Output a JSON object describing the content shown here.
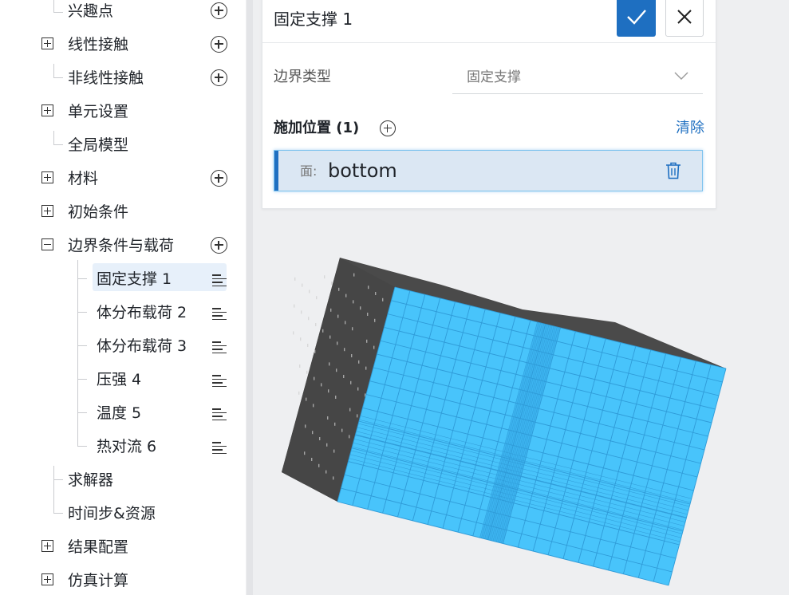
{
  "tree": {
    "items": [
      {
        "label": "兴趣点",
        "expander": "none",
        "action": "add"
      },
      {
        "label": "线性接触",
        "expander": "plus",
        "action": "add"
      },
      {
        "label": "非线性接触",
        "expander": "none",
        "action": "add"
      },
      {
        "label": "单元设置",
        "expander": "plus",
        "action": "none"
      },
      {
        "label": "全局模型",
        "expander": "none",
        "action": "none"
      },
      {
        "label": "材料",
        "expander": "plus",
        "action": "add"
      },
      {
        "label": "初始条件",
        "expander": "plus",
        "action": "none"
      },
      {
        "label": "边界条件与载荷",
        "expander": "minus",
        "action": "add"
      },
      {
        "label": "求解器",
        "expander": "none",
        "action": "none"
      },
      {
        "label": "时间步&资源",
        "expander": "none",
        "action": "none"
      },
      {
        "label": "结果配置",
        "expander": "plus",
        "action": "none"
      },
      {
        "label": "仿真计算",
        "expander": "plus",
        "action": "none"
      }
    ],
    "children": [
      {
        "label": "固定支撑 1",
        "selected": true
      },
      {
        "label": "体分布载荷 2",
        "selected": false
      },
      {
        "label": "体分布载荷 3",
        "selected": false
      },
      {
        "label": "压强 4",
        "selected": false
      },
      {
        "label": "温度 5",
        "selected": false
      },
      {
        "label": "热对流 6",
        "selected": false
      }
    ]
  },
  "panel": {
    "title": "固定支撑 1",
    "confirm_icon": "check-icon",
    "close_icon": "close-icon",
    "boundary_type_label": "边界类型",
    "boundary_type_value": "固定支撑",
    "location_label": "施加位置 (1)",
    "clear_label": "清除",
    "location_item": {
      "prefix": "面:",
      "value": "bottom"
    }
  },
  "colors": {
    "accent": "#1e6fc1",
    "mesh_face": "#48c4fb",
    "mesh_lines": "#2f9bd8",
    "model_dark": "#4a4a4a",
    "selected_bg": "#e7f0fa"
  }
}
